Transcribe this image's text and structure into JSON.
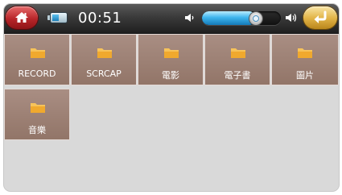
{
  "status_bar": {
    "time": "00:51",
    "volume_level": 0.68,
    "battery_level": 0.5
  },
  "folders": [
    {
      "label": "RECORD"
    },
    {
      "label": "SCRCAP"
    },
    {
      "label": "電影"
    },
    {
      "label": "電子書"
    },
    {
      "label": "圖片"
    },
    {
      "label": "音樂"
    }
  ],
  "icons": {
    "home": "home-icon",
    "battery": "battery-icon",
    "volume_down": "volume-down-icon",
    "volume_up": "volume-up-icon",
    "back": "back-arrow-icon",
    "folder": "folder-icon"
  },
  "colors": {
    "home_button": "#b8262a",
    "back_button": "#e3b64a",
    "volume_fill": "#3fb6ee",
    "tile": "#9c8074",
    "folder": "#f5b845"
  }
}
